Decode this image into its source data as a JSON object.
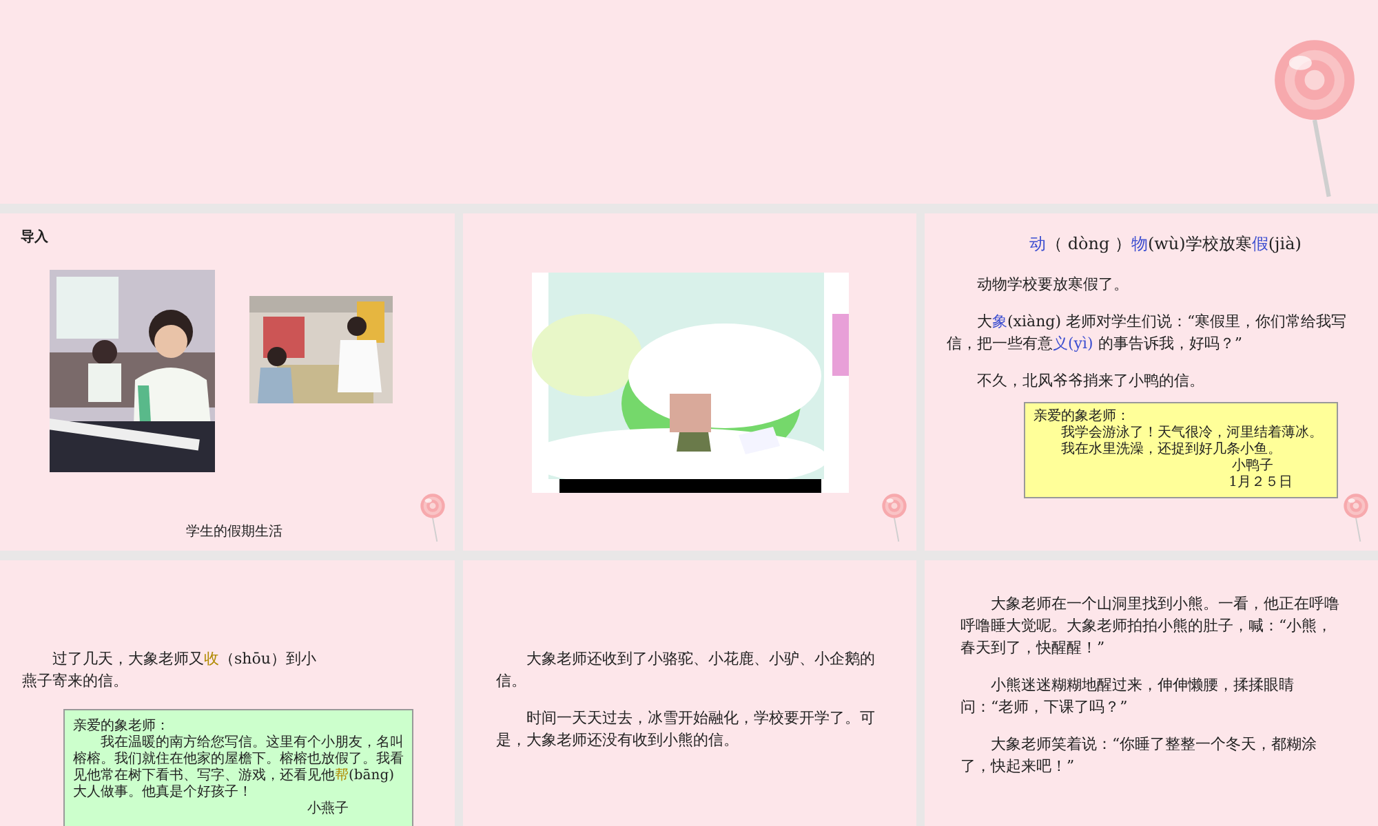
{
  "slides": [
    {
      "kind": "blank",
      "lollipop": true
    },
    {
      "kind": "intro",
      "lollipop": true,
      "heading": "导入",
      "caption": "学生的假期生活"
    },
    {
      "kind": "cover",
      "lollipop": true
    },
    {
      "kind": "text",
      "lollipop": true,
      "title": [
        {
          "kind": "blue",
          "text": "动"
        },
        {
          "kind": "plain",
          "text": "（ dòng ）"
        },
        {
          "kind": "blue",
          "text": "物"
        },
        {
          "kind": "plain",
          "text": "(wù)学校放寒"
        },
        {
          "kind": "blue",
          "text": "假"
        },
        {
          "kind": "plain",
          "text": "(jià)"
        }
      ],
      "paragraphs": [
        [
          {
            "kind": "plain",
            "text": "动物学校要放寒假了。"
          }
        ],
        [
          {
            "kind": "plain",
            "text": "大"
          },
          {
            "kind": "blue",
            "text": "象"
          },
          {
            "kind": "plain",
            "text": "(xiàng) 老师对学生们说：“寒假里，你们常给我写信，把一些有意"
          },
          {
            "kind": "blue",
            "text": "义(yì)"
          },
          {
            "kind": "plain",
            "text": " 的事告诉我，好吗？”"
          }
        ],
        [
          {
            "kind": "plain",
            "text": "不久，北风爷爷捎来了小鸭的信。"
          }
        ]
      ],
      "letter": {
        "color": "#ffff99",
        "greeting": "亲爱的象老师：",
        "body": [
          [
            {
              "kind": "plain",
              "text": "我学会游泳了！天气很冷，河里结着薄冰。"
            }
          ],
          [
            {
              "kind": "plain",
              "text": "我在水里洗澡，还捉到好几条小鱼。"
            }
          ]
        ],
        "signature": "小鸭子",
        "date": "1月２５日"
      }
    },
    {
      "kind": "text",
      "lollipop": false,
      "paragraphs": [
        [
          {
            "kind": "plain",
            "text": "过了几天，大象老师又"
          },
          {
            "kind": "pale",
            "text": "收"
          },
          {
            "kind": "plain",
            "text": "（shōu）到小燕子寄来的信。"
          }
        ]
      ],
      "letter": {
        "color": "#ccffcc",
        "greeting": "亲爱的象老师：",
        "body": [
          [
            {
              "kind": "plain",
              "text": "我在温暖的南方给您写信。这里有个小朋友，名叫榕榕。我们就住在他家的屋檐下。榕榕也放假了。我看见他常在树下看书、写字、游戏，还看见他"
            },
            {
              "kind": "pale",
              "text": "帮"
            },
            {
              "kind": "plain",
              "text": "(bāng) 大人做事。他真是个好孩子！"
            }
          ]
        ],
        "signature": "小燕子"
      }
    },
    {
      "kind": "text",
      "lollipop": false,
      "paragraphs": [
        [
          {
            "kind": "plain",
            "text": "大象老师还收到了小骆驼、小花鹿、小驴、小企鹅的信。"
          }
        ],
        [
          {
            "kind": "plain",
            "text": "时间一天天过去，冰雪开始融化，学校要开学了。可是，大象老师还没有收到小熊的信。"
          }
        ]
      ]
    },
    {
      "kind": "text",
      "lollipop": false,
      "paragraphs": [
        [
          {
            "kind": "plain",
            "text": "大象老师在一个山洞里找到小熊。一看，他正在呼噜呼噜睡大觉呢。大象老师拍拍小熊的肚子，喊：“小熊，春天到了，快醒醒！”"
          }
        ],
        [
          {
            "kind": "plain",
            "text": "小熊迷迷糊糊地醒过来，伸伸懒腰，揉揉眼睛问：“老师，下课了吗？”"
          }
        ],
        [
          {
            "kind": "plain",
            "text": "大象老师笑着说：“你睡了整整一个冬天，都糊涂了，快起来吧！”"
          }
        ]
      ]
    }
  ]
}
